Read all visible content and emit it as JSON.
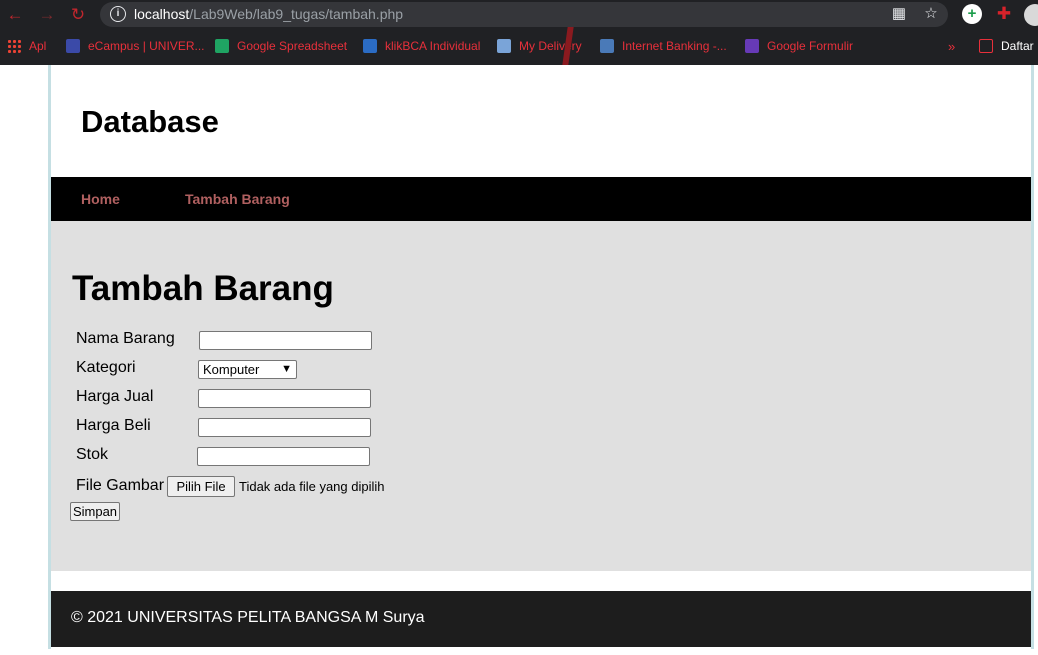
{
  "browser": {
    "url_host": "localhost",
    "url_path": "/Lab9Web/lab9_tugas/tambah.php",
    "bookmarks": [
      {
        "label": "Apl",
        "icon": "apps-grid-icon",
        "color": "#e8eaed"
      },
      {
        "label": "eCampus | UNIVER...",
        "icon": "university-icon",
        "color": "#3b4aa8"
      },
      {
        "label": "Google Spreadsheet",
        "icon": "google-sheets-icon",
        "color": "#1fa463"
      },
      {
        "label": "klikBCA Individual",
        "icon": "bca-icon",
        "color": "#2b6cc4"
      },
      {
        "label": "My Delivery",
        "icon": "delivery-icon",
        "color": "#7aa4d8"
      },
      {
        "label": "Internet Banking -...",
        "icon": "bank-icon",
        "color": "#4a7ab8"
      },
      {
        "label": "Google Formulir",
        "icon": "google-forms-icon",
        "color": "#673ab7"
      }
    ],
    "more_bookmarks": "»",
    "reading_list": "Daftar"
  },
  "site": {
    "title": "Database",
    "nav": [
      "Home",
      "Tambah Barang"
    ]
  },
  "form": {
    "heading": "Tambah Barang",
    "fields": {
      "nama_barang": {
        "label": "Nama Barang",
        "value": ""
      },
      "kategori": {
        "label": "Kategori",
        "value": "Komputer"
      },
      "harga_jual": {
        "label": "Harga Jual",
        "value": ""
      },
      "harga_beli": {
        "label": "Harga Beli",
        "value": ""
      },
      "stok": {
        "label": "Stok",
        "value": ""
      },
      "file_gambar": {
        "label": "File Gambar",
        "button": "Pilih File",
        "status": "Tidak ada file yang dipilih"
      }
    },
    "submit": "Simpan"
  },
  "footer": {
    "text": "© 2021 UNIVERSITAS PELITA BANGSA M Surya"
  },
  "colors": {
    "nav_link": "#b06060",
    "bookmark_text": "#e8303b",
    "content_bg": "#e0e0e0",
    "footer_bg": "#1d1d1d"
  }
}
